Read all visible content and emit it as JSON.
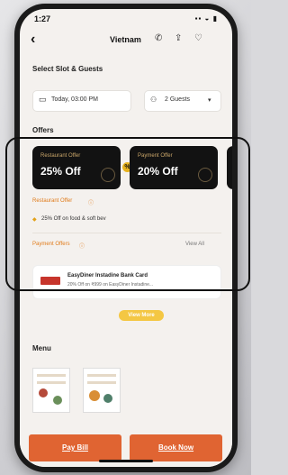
{
  "status": {
    "time": "1:27",
    "indicators": "▪▪ ◒ ▮"
  },
  "header": {
    "back": "‹",
    "title": "Vietnam"
  },
  "slot": {
    "title": "Select Slot & Guests",
    "date_value": "Today, 03:00 PM",
    "guests_value": "2 Guests"
  },
  "offers": {
    "title": "Offers",
    "cards": [
      {
        "caption": "Restaurant Offer",
        "value": "25% Off"
      },
      {
        "caption": "Payment Offer",
        "value": "20% Off"
      }
    ],
    "restaurant_offer_label": "Restaurant Offer",
    "restaurant_offer_detail": "25% Off on food & soft bev",
    "payment_offers_label": "Payment Offers",
    "view_all": "View All",
    "bank_offer_title": "EasyDiner Instadine Bank Card",
    "bank_offer_detail": "20% Off on ₹999 on EasyDiner Instadine..."
  },
  "more_label": "View More",
  "menu": {
    "title": "Menu"
  },
  "actions": {
    "pay_label": "Pay Bill",
    "book_label": "Book Now"
  }
}
